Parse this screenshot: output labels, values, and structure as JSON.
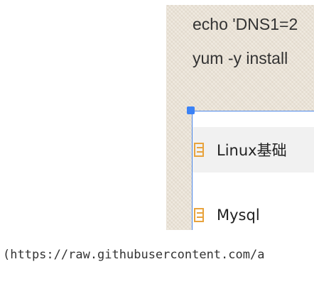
{
  "screenshot": {
    "code_lines": [
      "echo 'DNS1=2",
      "yum -y install"
    ],
    "menu_items": [
      {
        "label": "Linux基础",
        "icon": "document-icon"
      },
      {
        "label": "Mysql",
        "icon": "document-icon"
      }
    ],
    "colors": {
      "selection_border": "#4a86e8",
      "handle": "#3b82f6",
      "icon": "#e8a33d"
    }
  },
  "markdown": {
    "url_fragment": "(https://raw.githubusercontent.com/a"
  }
}
